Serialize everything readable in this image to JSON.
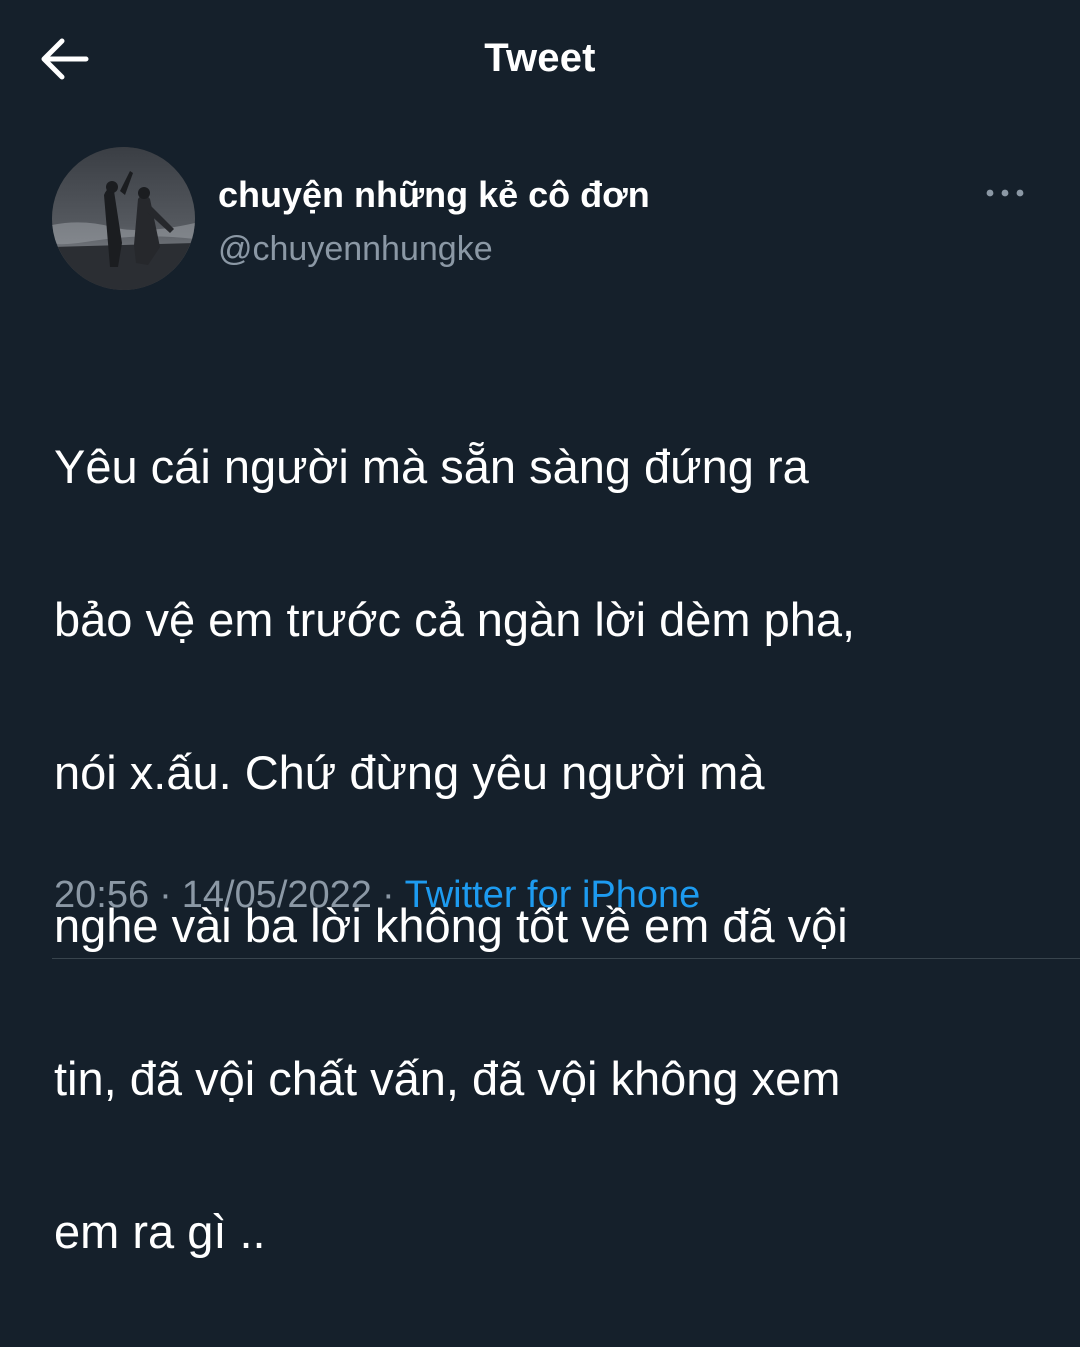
{
  "header": {
    "title": "Tweet",
    "back_icon": "arrow-left-icon"
  },
  "author": {
    "display_name": "chuyện những kẻ cô đơn",
    "handle": "@chuyennhungke",
    "more_icon": "more-horizontal-icon"
  },
  "tweet": {
    "lines": [
      "Yêu cái người mà sẵn sàng đứng ra",
      "bảo vệ em trước cả ngàn lời dèm pha,",
      "nói x.ấu. Chứ đừng yêu người mà",
      "nghe vài ba lời không tốt về em đã vội",
      "tin, đã vội chất vấn, đã vội không xem",
      "em ra gì .."
    ]
  },
  "meta": {
    "time": "20:56",
    "separator": "·",
    "date": "14/05/2022",
    "source": "Twitter for iPhone"
  },
  "colors": {
    "background": "#15202b",
    "secondary_text": "#8b98a5",
    "link": "#1d9bf0"
  }
}
